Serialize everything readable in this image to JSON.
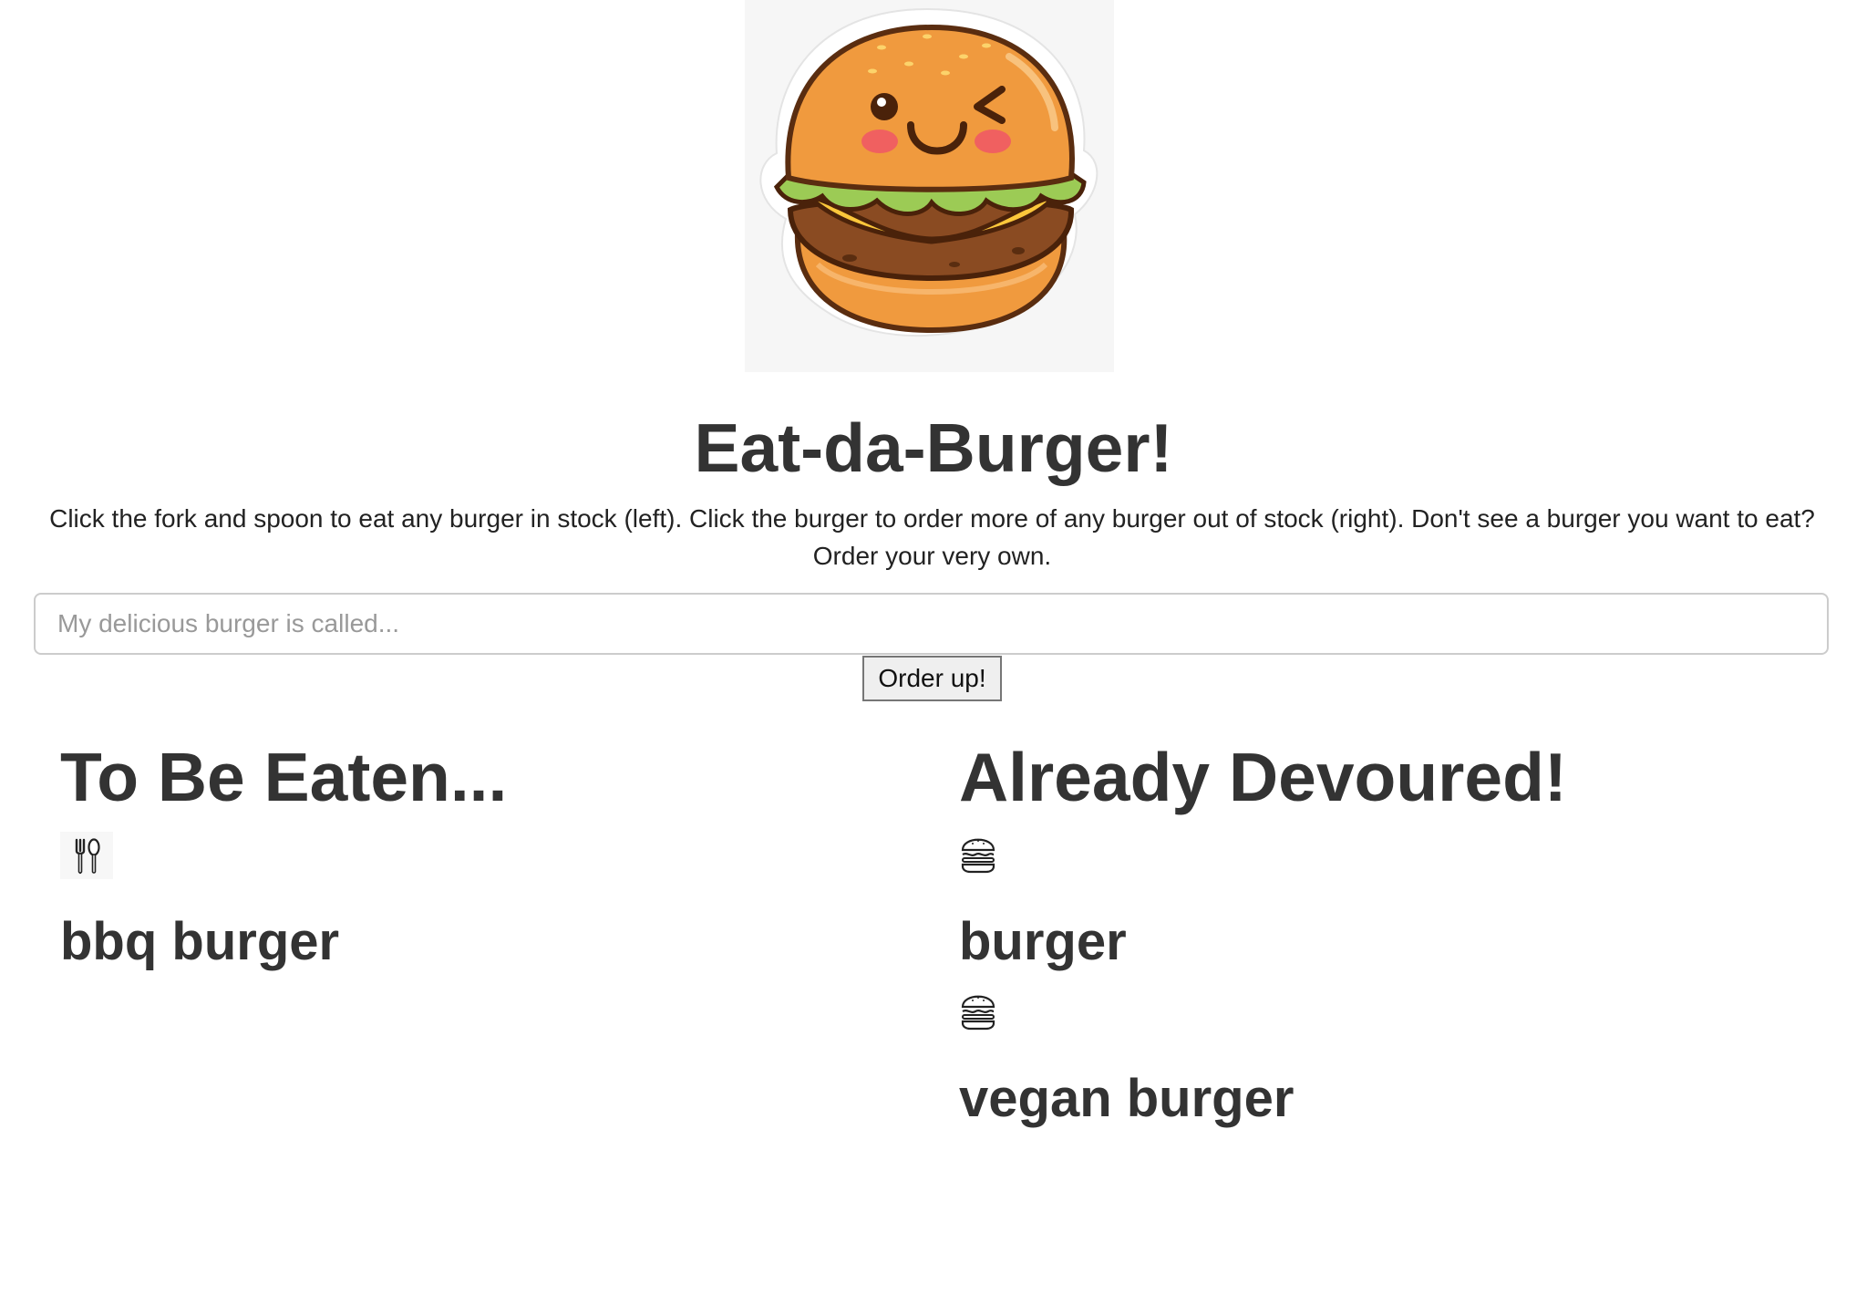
{
  "header": {
    "logo_icon": "burger-mascot-icon",
    "title": "Eat-da-Burger!",
    "instructions": "Click the fork and spoon to eat any burger in stock (left). Click the burger to order more of any burger out of stock (right). Don't see a burger you want to eat? Order your very own."
  },
  "form": {
    "placeholder": "My delicious burger is called...",
    "value": "",
    "submit_label": "Order up!"
  },
  "to_be_eaten": {
    "heading": "To Be Eaten...",
    "action_icon": "fork-and-spoon-icon",
    "items": [
      {
        "name": "bbq burger"
      }
    ]
  },
  "devoured": {
    "heading": "Already Devoured!",
    "action_icon": "burger-icon",
    "items": [
      {
        "name": "burger"
      },
      {
        "name": "vegan burger"
      }
    ]
  },
  "colors": {
    "text": "#333333",
    "bun": "#f09a3e",
    "lettuce": "#9ccb55",
    "cheese": "#fcc73b",
    "patty": "#8a4b22"
  }
}
